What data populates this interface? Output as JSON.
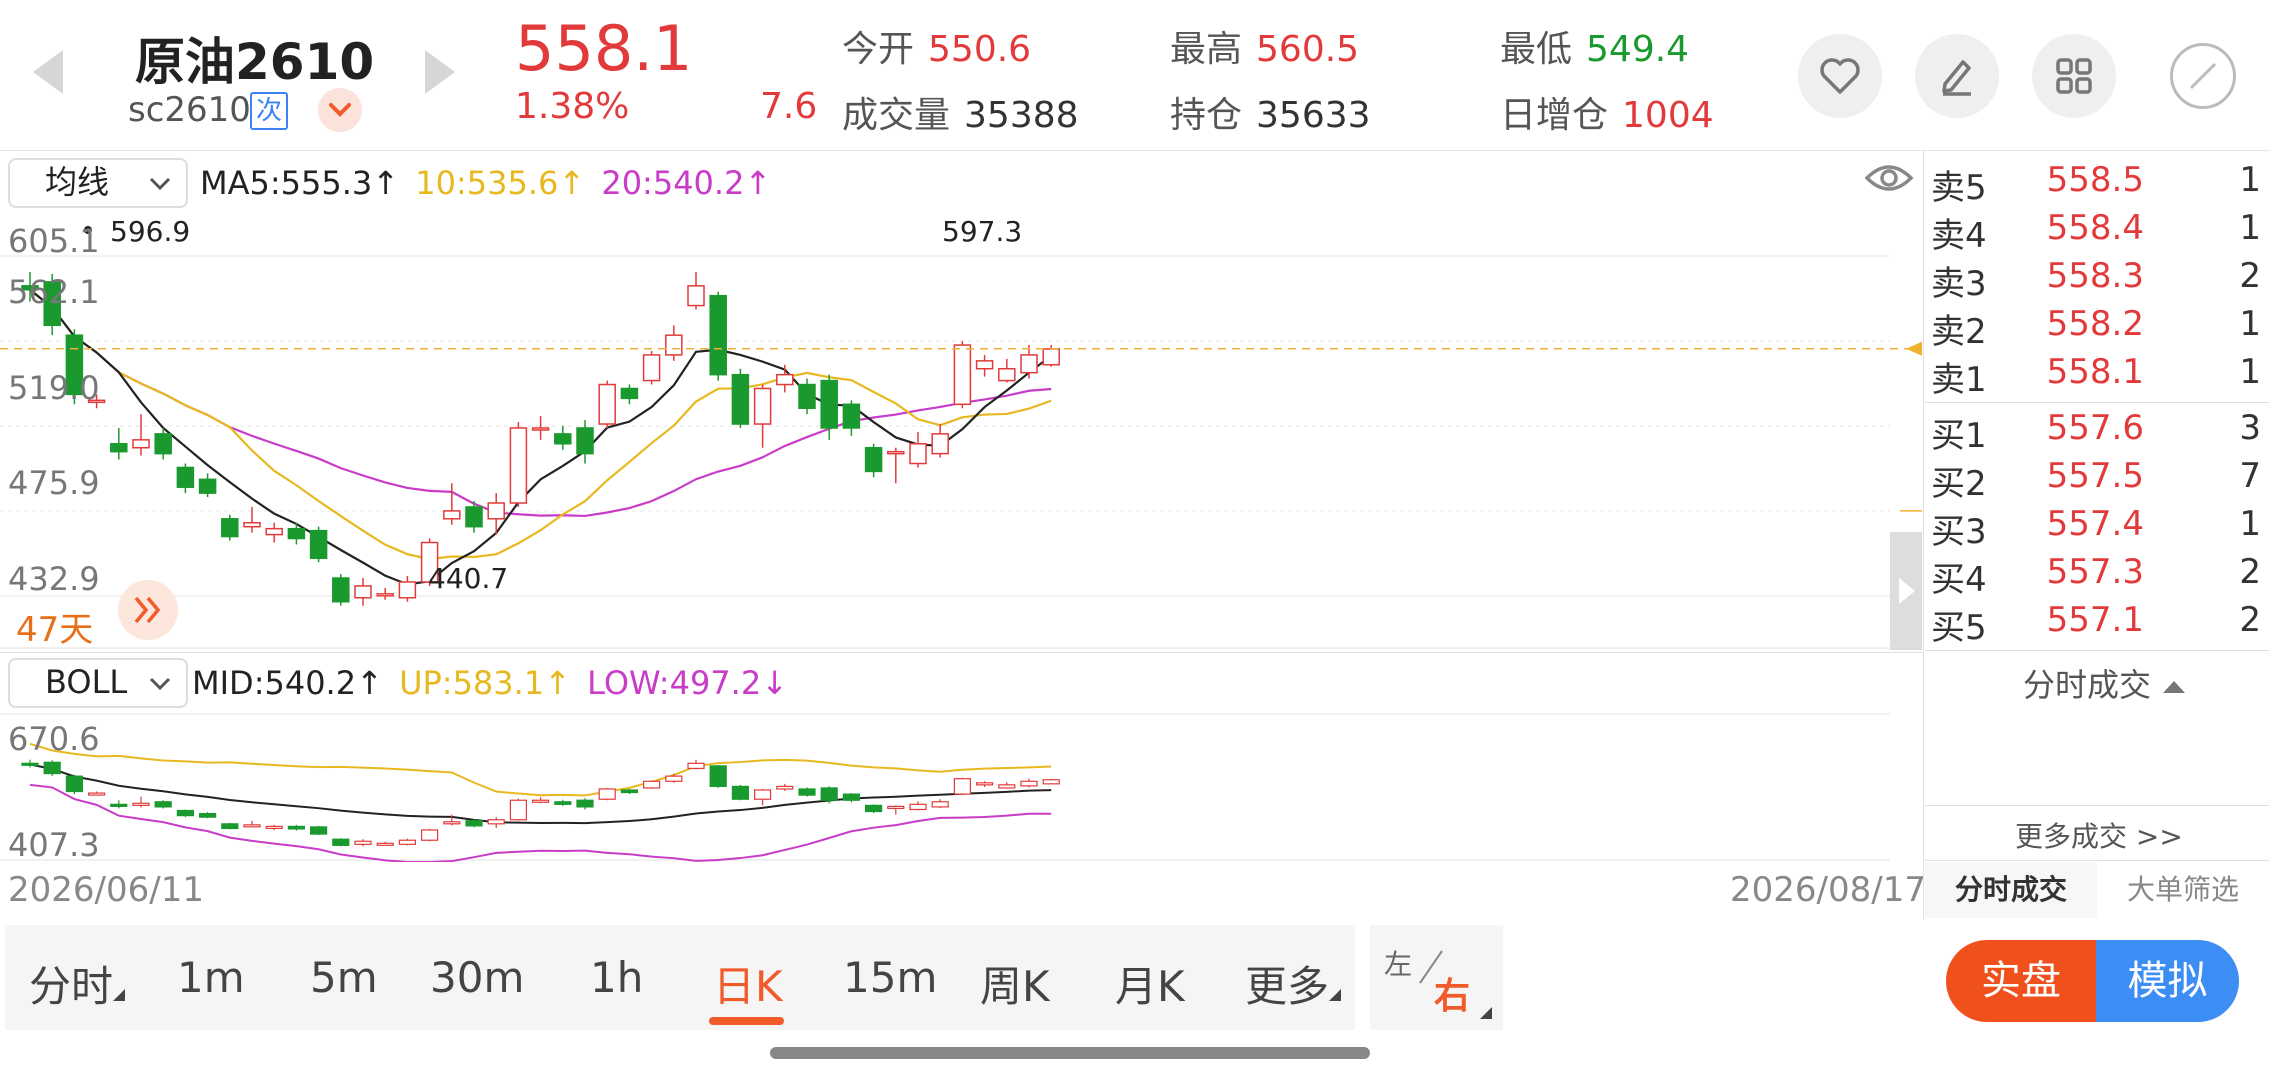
{
  "header": {
    "title": "原油2610",
    "code": "sc2610",
    "code_badge": "次",
    "price": "558.1",
    "change_pct": "1.38%",
    "change": "7.6",
    "open_label": "今开",
    "open": "550.6",
    "high_label": "最高",
    "high": "560.5",
    "low_label": "最低",
    "low": "549.4",
    "volume_label": "成交量",
    "volume": "35388",
    "oi_label": "持仓",
    "oi": "35633",
    "oi_chg_label": "日增仓",
    "oi_chg": "1004"
  },
  "kline": {
    "indicator_select": "均线",
    "ma5": "MA5:555.3↑",
    "ma10": "10:535.6↑",
    "ma20": "20:540.2↑",
    "y_labels": [
      "605.1",
      "562.1",
      "519.0",
      "475.9",
      "432.9"
    ],
    "high_mark": "597.3",
    "low_mark": "440.7",
    "first_mark": "596.9",
    "days": "47天"
  },
  "boll": {
    "indicator_select": "BOLL",
    "mid": "MID:540.2↑",
    "up": "UP:583.1↑",
    "low": "LOW:497.2↓",
    "y_top": "670.6",
    "y_bottom": "407.3"
  },
  "dates": {
    "start": "2026/06/11",
    "end": "2026/08/17"
  },
  "orderbook": {
    "asks": [
      {
        "label": "卖5",
        "price": "558.5",
        "vol": "1"
      },
      {
        "label": "卖4",
        "price": "558.4",
        "vol": "1"
      },
      {
        "label": "卖3",
        "price": "558.3",
        "vol": "2"
      },
      {
        "label": "卖2",
        "price": "558.2",
        "vol": "1"
      },
      {
        "label": "卖1",
        "price": "558.1",
        "vol": "1"
      }
    ],
    "bids": [
      {
        "label": "买1",
        "price": "557.6",
        "vol": "3"
      },
      {
        "label": "买2",
        "price": "557.5",
        "vol": "7"
      },
      {
        "label": "买3",
        "price": "557.4",
        "vol": "1"
      },
      {
        "label": "买4",
        "price": "557.3",
        "vol": "2"
      },
      {
        "label": "买5",
        "price": "557.1",
        "vol": "2"
      }
    ],
    "ticks_title": "分时成交",
    "more_ticks": "更多成交 >>",
    "tab_ticks": "分时成交",
    "tab_big": "大单筛选"
  },
  "tabs": [
    "分时",
    "1m",
    "5m",
    "30m",
    "1h",
    "日K",
    "15m",
    "周K",
    "月K",
    "更多"
  ],
  "active_tab": "日K",
  "lr": {
    "left": "左",
    "right": "右"
  },
  "mode": {
    "real": "实盘",
    "sim": "模拟"
  },
  "colors": {
    "up": "#e23a3a",
    "down": "#1a9a2e",
    "accent": "#f15a29",
    "ma5": "#222222",
    "ma10": "#e8b820",
    "ma20": "#c83cc8",
    "sim": "#3d8ef4"
  },
  "chart_data": {
    "type": "candlestick",
    "y_range": [
      432.9,
      605.1
    ],
    "candles": [
      {
        "o": 590,
        "c": 588,
        "h": 597,
        "l": 582
      },
      {
        "o": 592,
        "c": 570,
        "h": 596,
        "l": 565
      },
      {
        "o": 565,
        "c": 535,
        "h": 568,
        "l": 530
      },
      {
        "o": 532,
        "c": 532,
        "h": 535,
        "l": 528
      },
      {
        "o": 510,
        "c": 506,
        "h": 518,
        "l": 502
      },
      {
        "o": 508,
        "c": 512,
        "h": 525,
        "l": 504
      },
      {
        "o": 515,
        "c": 505,
        "h": 518,
        "l": 502
      },
      {
        "o": 498,
        "c": 488,
        "h": 500,
        "l": 485
      },
      {
        "o": 492,
        "c": 485,
        "h": 495,
        "l": 483
      },
      {
        "o": 472,
        "c": 463,
        "h": 474,
        "l": 461
      },
      {
        "o": 468,
        "c": 470,
        "h": 478,
        "l": 465
      },
      {
        "o": 464,
        "c": 467,
        "h": 470,
        "l": 460
      },
      {
        "o": 467,
        "c": 462,
        "h": 470,
        "l": 459
      },
      {
        "o": 466,
        "c": 452,
        "h": 468,
        "l": 450
      },
      {
        "o": 442,
        "c": 430,
        "h": 444,
        "l": 428
      },
      {
        "o": 432,
        "c": 438,
        "h": 442,
        "l": 428
      },
      {
        "o": 434,
        "c": 434,
        "h": 437,
        "l": 431
      },
      {
        "o": 432,
        "c": 440,
        "h": 443,
        "l": 430
      },
      {
        "o": 440,
        "c": 460,
        "h": 462,
        "l": 438
      },
      {
        "o": 472,
        "c": 476,
        "h": 490,
        "l": 469
      },
      {
        "o": 478,
        "c": 468,
        "h": 481,
        "l": 465
      },
      {
        "o": 472,
        "c": 480,
        "h": 485,
        "l": 464
      },
      {
        "o": 480,
        "c": 518,
        "h": 521,
        "l": 478
      },
      {
        "o": 518,
        "c": 518,
        "h": 524,
        "l": 512
      },
      {
        "o": 515,
        "c": 510,
        "h": 519,
        "l": 507
      },
      {
        "o": 518,
        "c": 505,
        "h": 522,
        "l": 500
      },
      {
        "o": 520,
        "c": 540,
        "h": 542,
        "l": 518
      },
      {
        "o": 538,
        "c": 533,
        "h": 540,
        "l": 530
      },
      {
        "o": 542,
        "c": 555,
        "h": 557,
        "l": 540
      },
      {
        "o": 555,
        "c": 565,
        "h": 570,
        "l": 552
      },
      {
        "o": 580,
        "c": 590,
        "h": 597,
        "l": 578
      },
      {
        "o": 585,
        "c": 545,
        "h": 587,
        "l": 542
      },
      {
        "o": 545,
        "c": 520,
        "h": 548,
        "l": 518
      },
      {
        "o": 520,
        "c": 538,
        "h": 540,
        "l": 508
      },
      {
        "o": 540,
        "c": 545,
        "h": 550,
        "l": 536
      },
      {
        "o": 540,
        "c": 528,
        "h": 543,
        "l": 525
      },
      {
        "o": 542,
        "c": 518,
        "h": 545,
        "l": 512
      },
      {
        "o": 530,
        "c": 518,
        "h": 532,
        "l": 514
      },
      {
        "o": 508,
        "c": 496,
        "h": 510,
        "l": 493
      },
      {
        "o": 506,
        "c": 506,
        "h": 508,
        "l": 490
      },
      {
        "o": 500,
        "c": 510,
        "h": 516,
        "l": 498
      },
      {
        "o": 505,
        "c": 515,
        "h": 520,
        "l": 503
      },
      {
        "o": 530,
        "c": 560,
        "h": 562,
        "l": 528
      },
      {
        "o": 548,
        "c": 552,
        "h": 555,
        "l": 544
      },
      {
        "o": 542,
        "c": 548,
        "h": 553,
        "l": 541
      },
      {
        "o": 546,
        "c": 555,
        "h": 560,
        "l": 543
      },
      {
        "o": 550,
        "c": 558,
        "h": 560,
        "l": 549
      }
    ]
  }
}
